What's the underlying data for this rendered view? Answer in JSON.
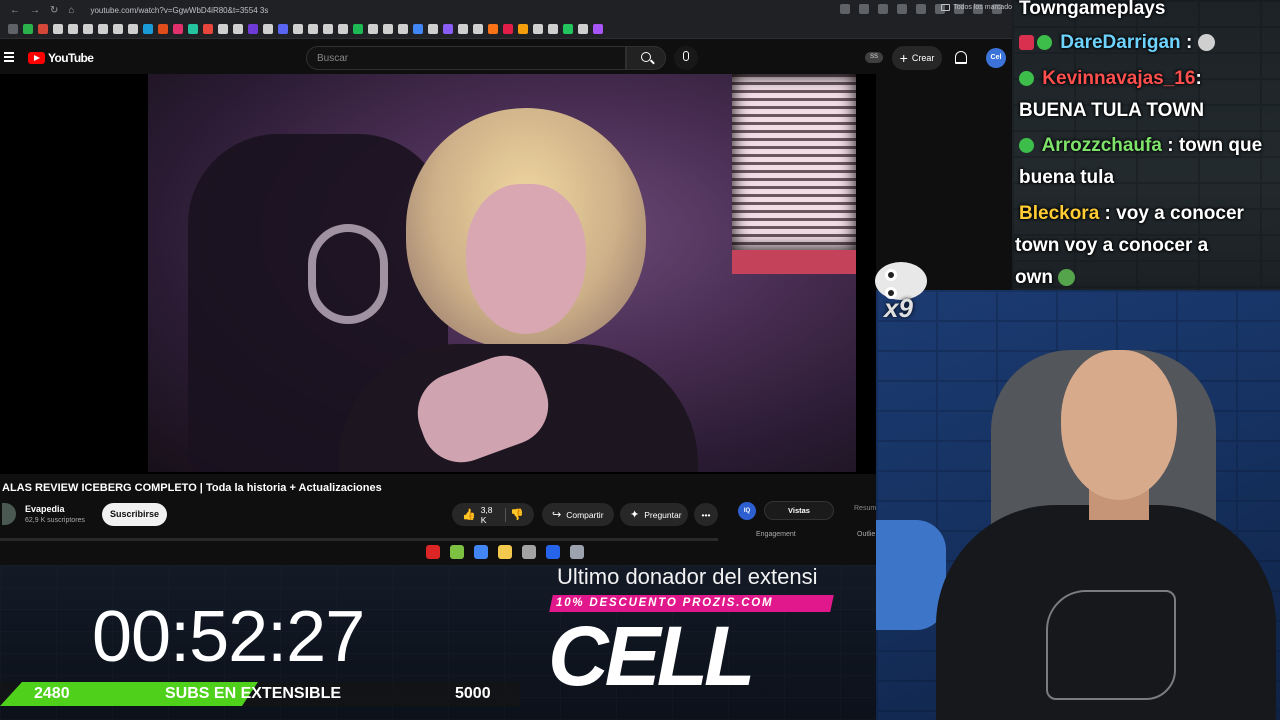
{
  "browser": {
    "url": "youtube.com/watch?v=GgwWbD4iR80&t=3554 3s",
    "bookmarks_folder": "Todos los marcado",
    "bookmark_colors": [
      "#5f6368",
      "#2bb24c",
      "#d44638",
      "#cfcfcf",
      "#cfcfcf",
      "#cfcfcf",
      "#cfcfcf",
      "#cfcfcf",
      "#cfcfcf",
      "#1a9cd8",
      "#e04c1a",
      "#e1306c",
      "#24c4a0",
      "#e8453c",
      "#cfcfcf",
      "#cfcfcf",
      "#6f3bd8",
      "#cfcfcf",
      "#5865f2",
      "#cfcfcf",
      "#cfcfcf",
      "#cfcfcf",
      "#cfcfcf",
      "#1db954",
      "#cfcfcf",
      "#cfcfcf",
      "#cfcfcf",
      "#4285f4",
      "#cfcfcf",
      "#8b5cf6",
      "#cfcfcf",
      "#cfcfcf",
      "#f97316",
      "#e11d48",
      "#f59e0b",
      "#cfcfcf",
      "#cfcfcf",
      "#22c55e",
      "#cfcfcf",
      "#a855f7"
    ]
  },
  "youtube": {
    "logo_text": "YouTube",
    "search_placeholder": "Buscar",
    "ss_badge": "SS",
    "create_label": "Crear",
    "avatar_text": "Cel",
    "video_title": "ALAS REVIEW ICEBERG COMPLETO | Toda la historia + Actualizaciones",
    "channel_name": "Evapedia",
    "channel_subs": "62,9 K suscriptores",
    "subscribe_label": "Suscribirse",
    "likes": "3,8 K",
    "share_label": "Compartir",
    "ask_label": "Preguntar",
    "panel": {
      "badge": "IQ",
      "tab_views": "Vistas",
      "tab_summary": "Resum",
      "label_engagement": "Engagement",
      "label_outlier": "Outlie"
    },
    "taskbar_colors": [
      "#dc2626",
      "#7cc142",
      "#4285f4",
      "#f2c94c",
      "#a3a3a3",
      "#2563eb",
      "#9ca3af"
    ]
  },
  "overlay": {
    "timer": "00:52:27",
    "goal_current": "2480",
    "goal_label": "SUBS EN EXTENSIBLE",
    "goal_target": "5000",
    "goal_progress": 0.496,
    "donor_title": "Ultimo donador del extensi",
    "promo_text": "10% DESCUENTO PROZIS.COM",
    "donor_name": "CELL"
  },
  "chat": {
    "line1": "Towngameplays",
    "line2_user": "DareDarrigan",
    "line2_sep": " :",
    "line3_user": "Kevinnavajas_16",
    "line3_sep": ":",
    "line4": "BUENA TULA TOWN",
    "line5_user": "Arrozzchaufa",
    "line5_msg": " : town que",
    "line6": "buena tula",
    "line7_user": "Bleckora",
    "line7_msg": " : voy a conocer",
    "line8": "town voy a conocer a",
    "line9": "own",
    "colors": {
      "darrigan": "#6fd3ff",
      "kevin": "#ff4f4f",
      "arroz": "#7ee26b",
      "bleckora": "#ffcc33"
    }
  },
  "emote_combo": {
    "count": "x9"
  }
}
